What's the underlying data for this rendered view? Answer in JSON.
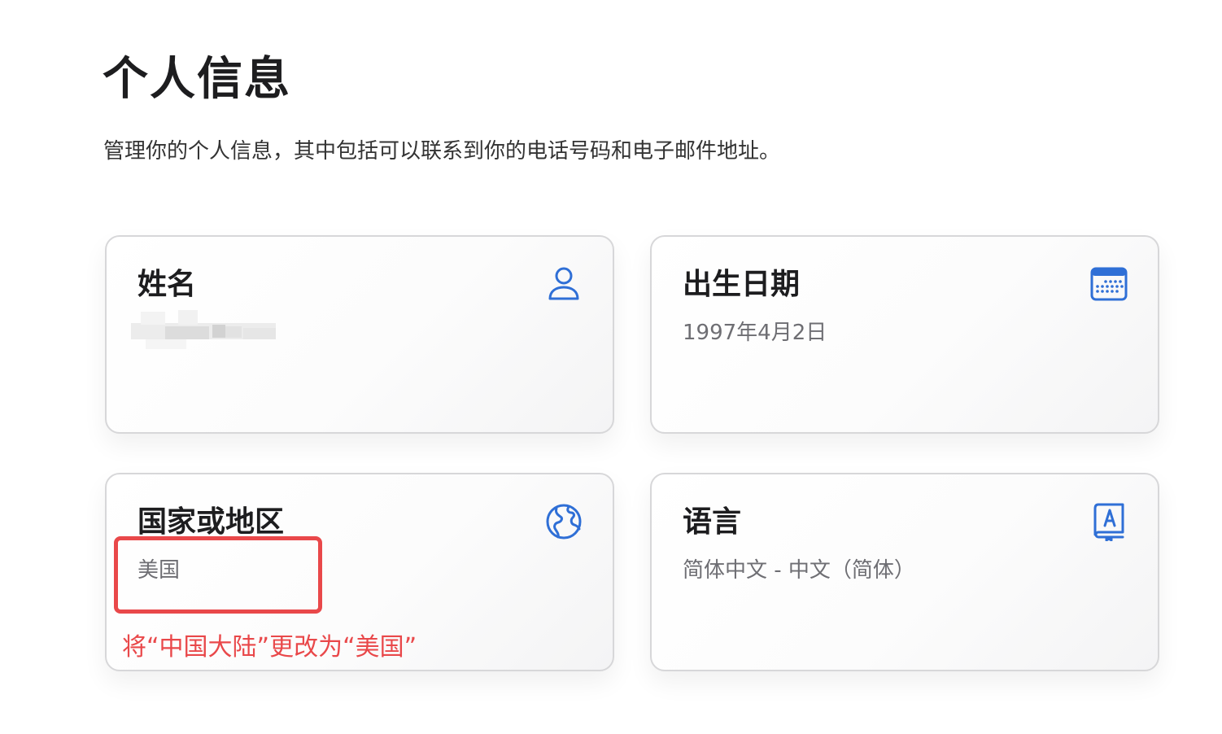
{
  "page": {
    "title": "个人信息",
    "subtitle": "管理你的个人信息，其中包括可以联系到你的电话号码和电子邮件地址。"
  },
  "cards": {
    "name": {
      "title": "姓名",
      "icon": "person-icon"
    },
    "birthday": {
      "title": "出生日期",
      "value": "1997年4月2日",
      "icon": "calendar-icon"
    },
    "country": {
      "title": "国家或地区",
      "value": "美国",
      "icon": "globe-icon"
    },
    "language": {
      "title": "语言",
      "value": "简体中文 - 中文（简体）",
      "icon": "dictionary-icon"
    }
  },
  "annotation": {
    "text": "将“中国大陆”更改为“美国”",
    "color": "#e9484a"
  },
  "colors": {
    "accent": "#2f6fd6",
    "title_text": "#1d1d1f",
    "value_text": "#6e6e73"
  }
}
